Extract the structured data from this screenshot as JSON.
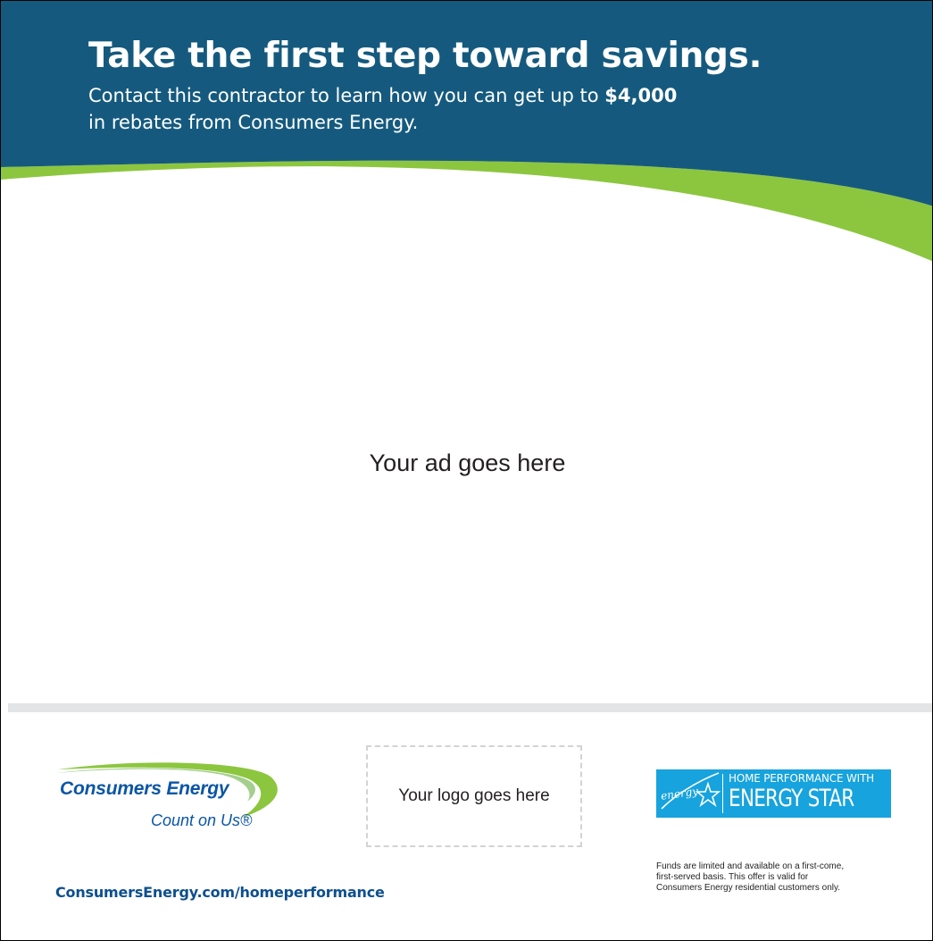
{
  "header": {
    "headline": "Take the first step toward savings.",
    "subhead_prefix": "Contact this contractor to learn how you can get up to ",
    "subhead_amount": "$4,000",
    "subhead_suffix": " in rebates from Consumers Energy."
  },
  "ad_area": {
    "placeholder": "Your ad goes here"
  },
  "footer": {
    "consumers_logo": {
      "name": "Consumers Energy",
      "tagline": "Count on Us®"
    },
    "logo_placeholder": "Your logo goes here",
    "energy_star_badge": {
      "script": "energy",
      "line1": "HOME PERFORMANCE WITH",
      "line2": "ENERGY STAR"
    },
    "disclaimer": [
      "Funds are limited and available on a first-come,",
      "first-served basis. This offer is valid for",
      "Consumers Energy residential customers only."
    ],
    "url": "ConsumersEnergy.com/homeperformance"
  },
  "colors": {
    "header_blue": "#155a7e",
    "accent_green": "#8cc63f",
    "brand_blue": "#0b56a4",
    "energy_star_blue": "#17a3dd",
    "link_blue": "#0d4f8f",
    "divider_gray": "#e3e4e5"
  }
}
